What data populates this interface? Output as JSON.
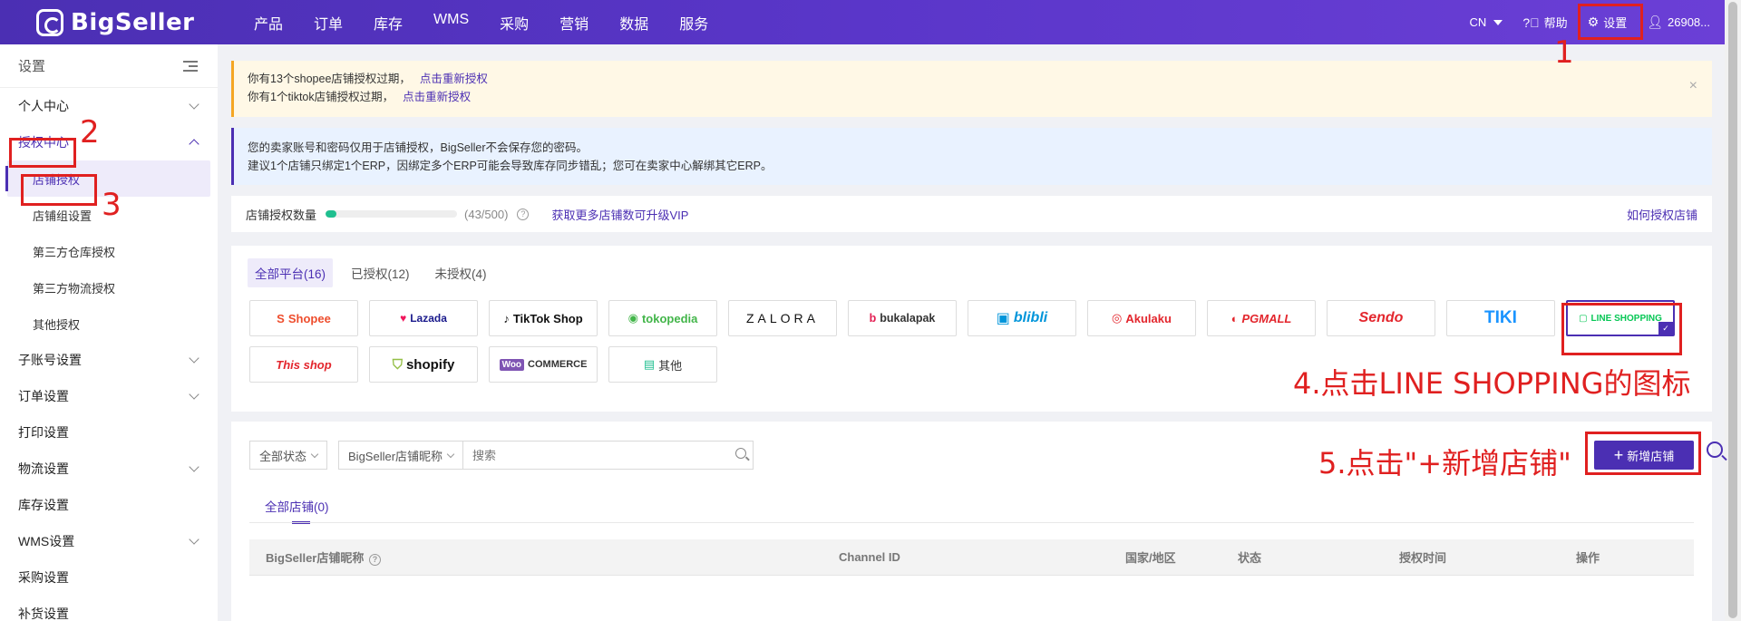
{
  "brand": {
    "name": "BigSeller",
    "accent": "#4b2fb3"
  },
  "nav": [
    "产品",
    "订单",
    "库存",
    "WMS",
    "采购",
    "营销",
    "数据",
    "服务"
  ],
  "topright": {
    "lang": "CN",
    "help": "帮助",
    "settings": "设置",
    "user": "26908..."
  },
  "sidebar": {
    "title": "设置",
    "groups": [
      {
        "label": "个人中心"
      },
      {
        "label": "授权中心"
      },
      {
        "label": "子账号设置"
      },
      {
        "label": "订单设置"
      },
      {
        "label": "打印设置"
      },
      {
        "label": "物流设置"
      },
      {
        "label": "库存设置"
      },
      {
        "label": "WMS设置"
      },
      {
        "label": "采购设置"
      },
      {
        "label": "补货设置"
      }
    ],
    "sub": [
      "店铺授权",
      "店铺组设置",
      "第三方仓库授权",
      "第三方物流授权",
      "其他授权"
    ]
  },
  "alerts": {
    "warn1": "你有13个shopee店铺授权过期，",
    "warn1_link": "点击重新授权",
    "warn2": "你有1个tiktok店铺授权过期，",
    "warn2_link": "点击重新授权",
    "close": "×",
    "info1": "您的卖家账号和密码仅用于店铺授权，BigSeller不会保存您的密码。",
    "info2": "建议1个店铺只绑定1个ERP，因绑定多个ERP可能会导致库存同步错乱；您可在卖家中心解绑其它ERP。"
  },
  "quota": {
    "label": "店铺授权数量",
    "count": "(43/500)",
    "progress": 0.086,
    "vip": "获取更多店铺数可升级VIP",
    "howto": "如何授权店铺",
    "help": "?"
  },
  "platform_tabs": [
    "全部平台(16)",
    "已授权(12)",
    "未授权(4)"
  ],
  "platforms": [
    {
      "name": "Shopee",
      "icon": "S"
    },
    {
      "name": "Lazada",
      "icon": "♥"
    },
    {
      "name": "TikTok Shop",
      "icon": "♪"
    },
    {
      "name": "tokopedia",
      "icon": "◉"
    },
    {
      "name": "ZALORA",
      "icon": ""
    },
    {
      "name": "bukalapak",
      "icon": "b"
    },
    {
      "name": "blibli",
      "icon": "▣"
    },
    {
      "name": "Akulaku",
      "icon": "◎"
    },
    {
      "name": "PGMALL",
      "icon": "◐"
    },
    {
      "name": "Sendo",
      "icon": ""
    },
    {
      "name": "TIKI",
      "icon": ""
    },
    {
      "name": "LINE SHOPPING",
      "icon": "▢"
    },
    {
      "name": "This shop",
      "icon": ""
    },
    {
      "name": "shopify",
      "icon": "⛉"
    },
    {
      "name": "COMMERCE",
      "icon": "Woo"
    },
    {
      "name": "其他",
      "icon": "▤"
    }
  ],
  "filters": {
    "status": "全部状态",
    "nickname": "BigSeller店铺昵称",
    "search_placeholder": "搜索"
  },
  "add_button": "新增店铺",
  "add_plus": "+",
  "store_tab": "全部店铺(0)",
  "table_headers": [
    "BigSeller店铺昵称",
    "Channel ID",
    "国家/地区",
    "状态",
    "授权时间",
    "操作"
  ],
  "annotations": {
    "n1": "1",
    "n2": "2",
    "n3": "3",
    "step4": "4.点击LINE SHOPPING的图标",
    "step5": "5.点击\"+新增店铺\""
  }
}
